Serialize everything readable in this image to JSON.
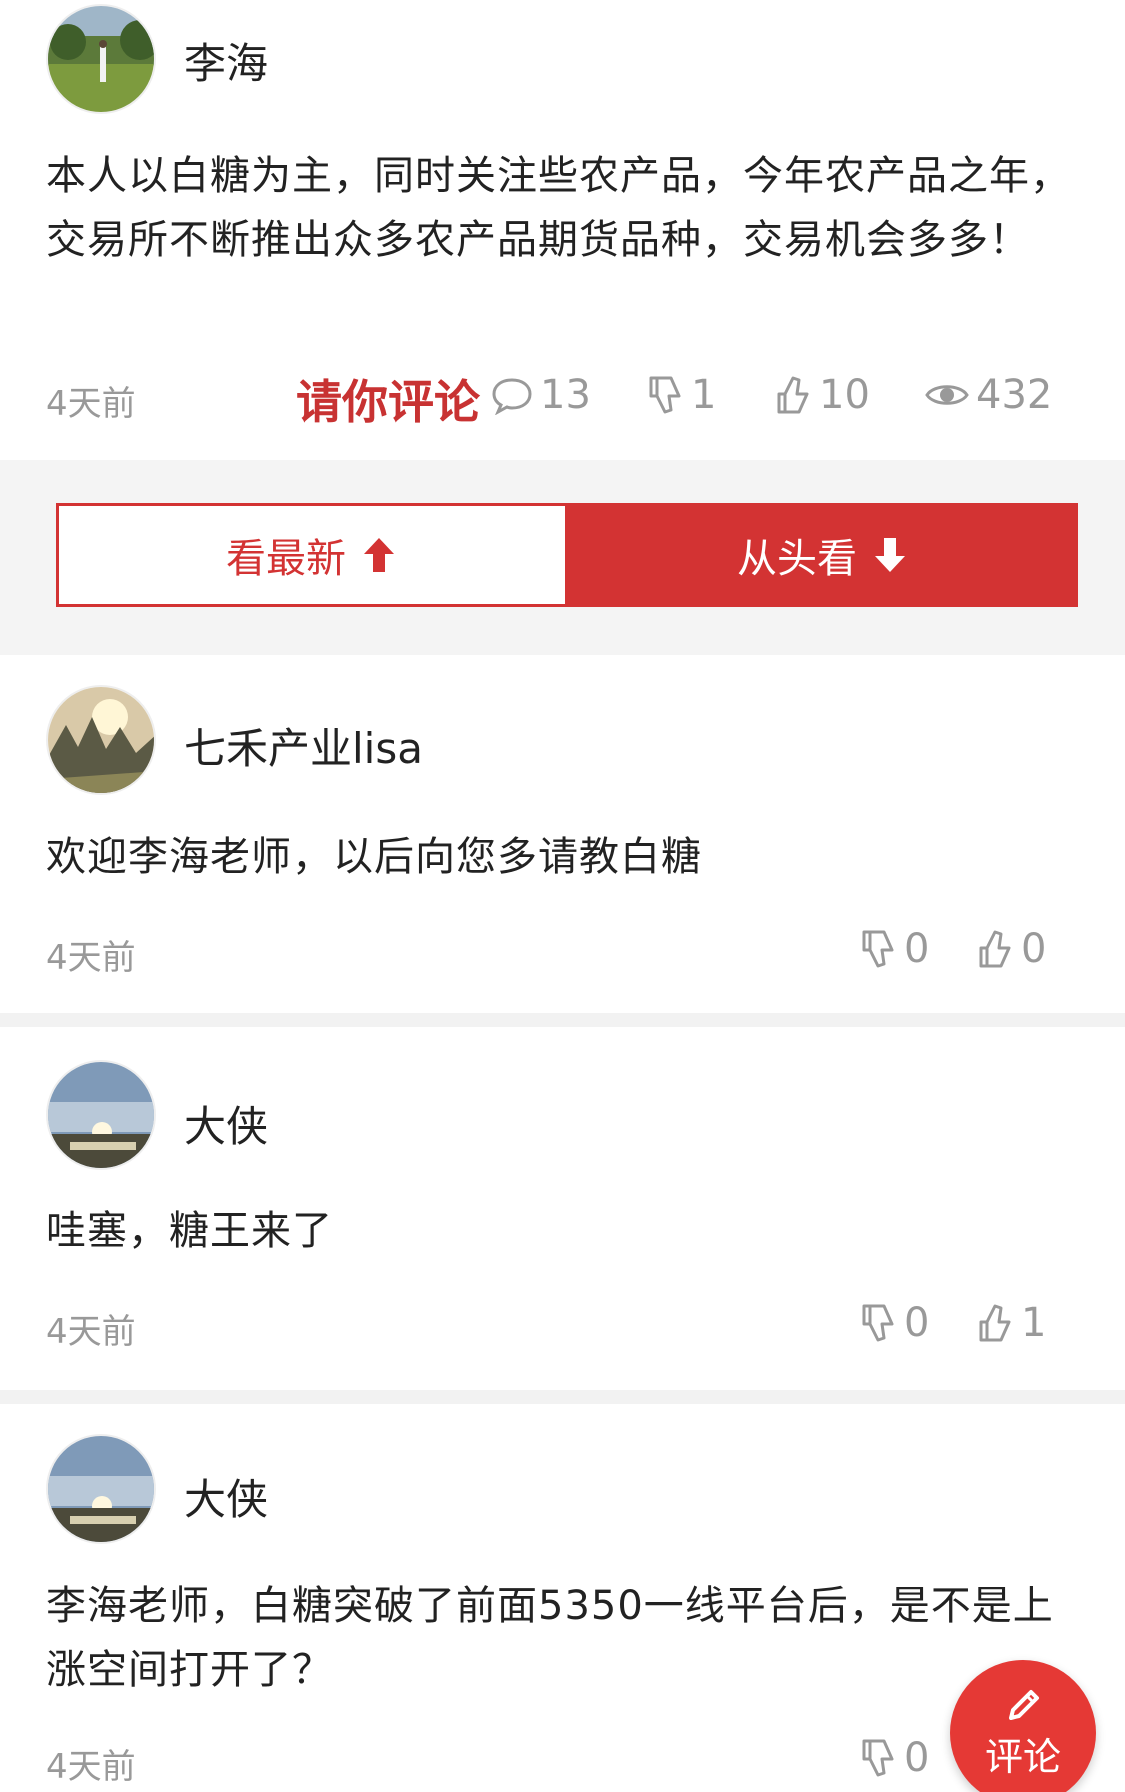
{
  "main_post": {
    "author": "李海",
    "text": "本人以白糖为主，同时关注些农产品，今年农产品之年，交易所不断推出众多农产品期货品种，交易机会多多！",
    "time": "4天前",
    "invite_label": "请你评论",
    "comments": "13",
    "dislikes": "1",
    "likes": "10",
    "views": "432"
  },
  "sort": {
    "newest_label": "看最新",
    "oldest_label": "从头看"
  },
  "comments": [
    {
      "author": "七禾产业lisa",
      "text": "欢迎李海老师，以后向您多请教白糖",
      "time": "4天前",
      "dislikes": "0",
      "likes": "0"
    },
    {
      "author": "大侠",
      "text": "哇塞，糖王来了",
      "time": "4天前",
      "dislikes": "0",
      "likes": "1"
    },
    {
      "author": "大侠",
      "text": "李海老师，白糖突破了前面5350一线平台后，是不是上涨空间打开了？",
      "time": "4天前",
      "dislikes": "0",
      "likes": ""
    }
  ],
  "fab": {
    "label": "评论"
  },
  "colors": {
    "accent": "#d33333",
    "muted": "#999999"
  },
  "icons": [
    "comment-icon",
    "thumbs-down-icon",
    "thumbs-up-icon",
    "eye-icon",
    "arrow-up-icon",
    "arrow-down-icon",
    "pencil-icon"
  ]
}
